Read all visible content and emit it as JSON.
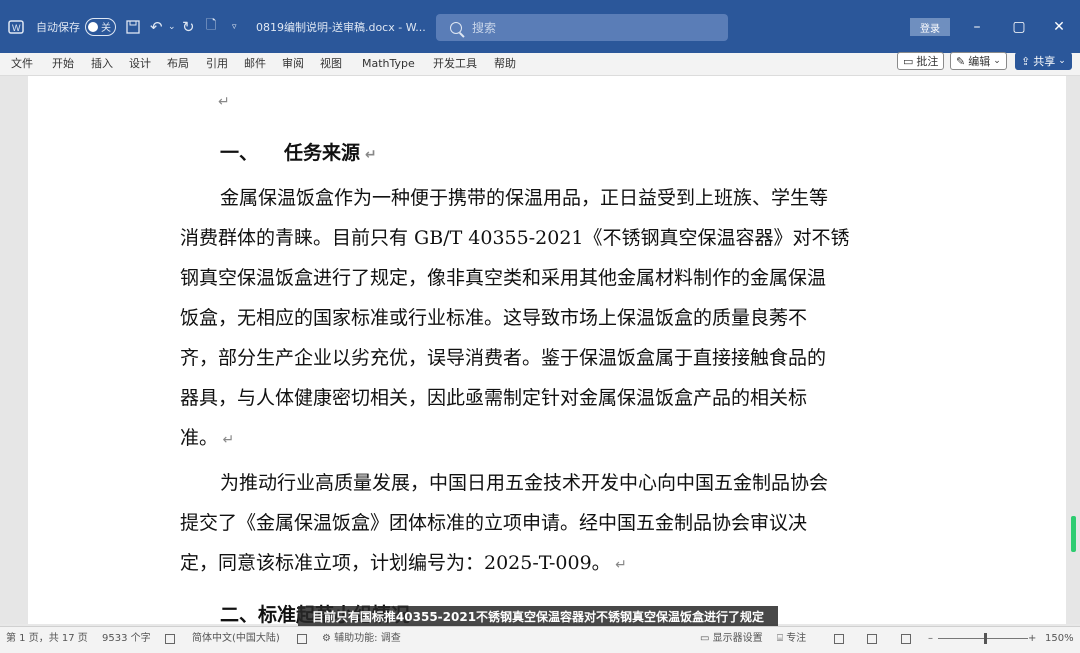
{
  "titlebar": {
    "autosave_label": "自动保存",
    "autosave_state": "关",
    "filename": "0819编制说明-送审稿.docx - W...",
    "search_placeholder": "搜索",
    "login_label": "登录"
  },
  "menu": [
    "文件",
    "开始",
    "插入",
    "设计",
    "布局",
    "引用",
    "邮件",
    "审阅",
    "视图",
    "MathType",
    "开发工具",
    "帮助"
  ],
  "ribbon_buttons": {
    "comments": "批注",
    "edit": "编辑",
    "share": "共享"
  },
  "document": {
    "blank_mark": "↵",
    "heading1": {
      "number": "一、",
      "text": "任务来源"
    },
    "para1": [
      "金属保温饭盒作为一种便于携带的保温用品，正日益受到上班族、学生等",
      "消费群体的青睐。目前只有 GB/T 40355-2021《不锈钢真空保温容器》对不锈",
      "钢真空保温饭盒进行了规定，像非真空类和采用其他金属材料制作的金属保温",
      "饭盒，无相应的国家标准或行业标准。这导致市场上保温饭盒的质量良莠不",
      "齐，部分生产企业以劣充优，误导消费者。鉴于保温饭盒属于直接接触食品的",
      "器具，与人体健康密切相关，因此亟需制定针对金属保温饭盒产品的相关标",
      "准。"
    ],
    "para2": [
      "为推动行业高质量发展，中国日用五金技术开发中心向中国五金制品协会",
      "提交了《金属保温饭盒》团体标准的立项申请。经中国五金制品协会审议决",
      "定，同意该标准立项，计划编号为：2025-T-009。"
    ],
    "heading2": "二、标准起草小组情况"
  },
  "caption": "目前只有国标推40355-2021不锈钢真空保温容器对不锈钢真空保温饭盒进行了规定",
  "statusbar": {
    "page_info": "第 1 页，共 17 页",
    "word_count": "9533 个字",
    "language": "简体中文(中国大陆)",
    "accessibility": "辅助功能: 调查",
    "display_settings": "显示器设置",
    "focus": "专注",
    "zoom": "150%"
  }
}
